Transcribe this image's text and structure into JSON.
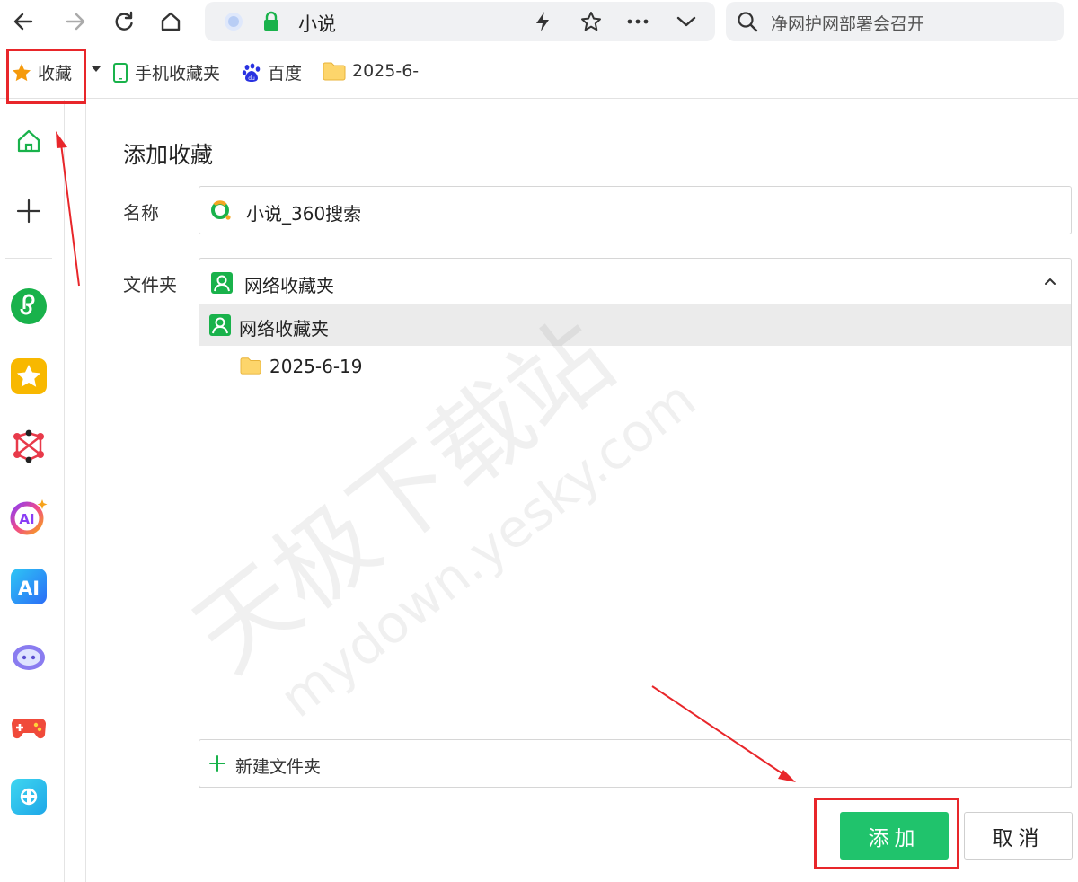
{
  "toolbar": {
    "address_text": "小说",
    "search_placeholder": "净网护网部署会召开"
  },
  "bookmarks_bar": {
    "favorites_label": "收藏",
    "items": [
      {
        "label": "手机收藏夹",
        "icon": "phone-icon"
      },
      {
        "label": "百度",
        "icon": "baidu-icon"
      },
      {
        "label": "2025-6-",
        "icon": "folder-icon"
      }
    ]
  },
  "sidebar": {
    "items": [
      {
        "icon": "home-icon"
      },
      {
        "icon": "plus-icon"
      },
      {
        "icon": "mini-program-icon"
      },
      {
        "icon": "star-app-icon"
      },
      {
        "icon": "network-app-icon"
      },
      {
        "icon": "ai-ring-icon"
      },
      {
        "icon": "ai-app-icon"
      },
      {
        "icon": "robot-icon"
      },
      {
        "icon": "game-icon"
      },
      {
        "icon": "link-app-icon"
      }
    ]
  },
  "dialog": {
    "title": "添加收藏",
    "name_label": "名称",
    "name_value": "小说_360搜索",
    "folder_label": "文件夹",
    "folder_value": "网络收藏夹",
    "tree": {
      "root": "网络收藏夹",
      "children": [
        "2025-6-19"
      ]
    },
    "new_folder_label": "新建文件夹",
    "add_label": "添加",
    "cancel_label": "取消"
  },
  "watermark": {
    "cn": "天极下载站",
    "url": "mydown.yesky.com"
  },
  "colors": {
    "accent_green": "#20c36c",
    "annotation_red": "#e8262a"
  }
}
